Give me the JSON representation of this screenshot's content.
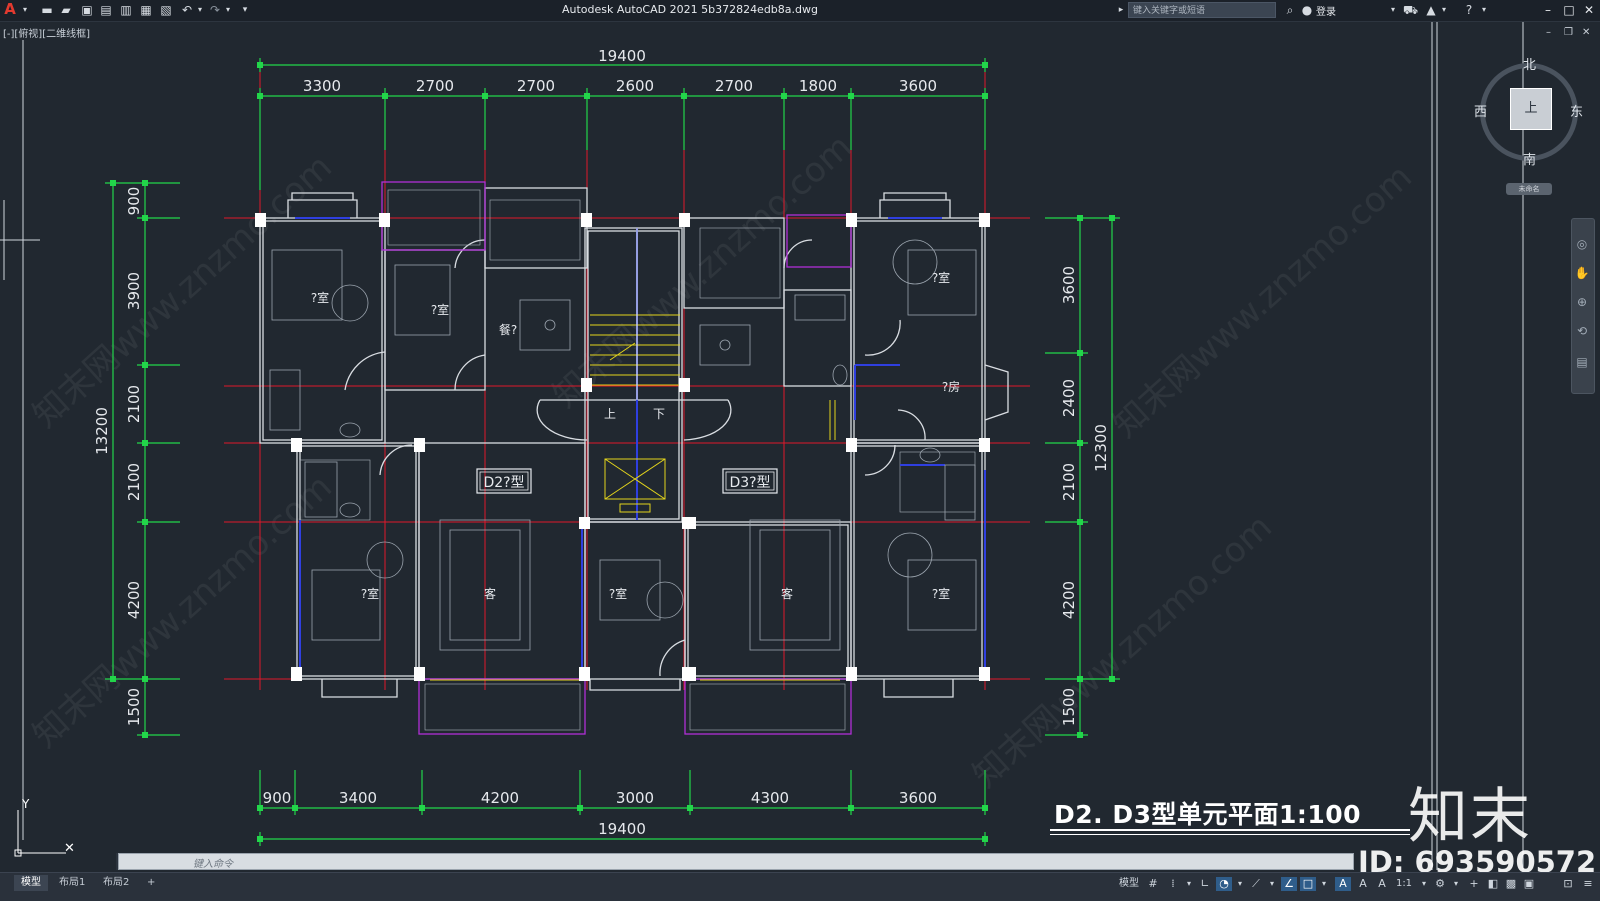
{
  "titlebar": {
    "app_title": "Autodesk AutoCAD 2021     5b372824edb8a.dwg",
    "search_placeholder": "键入关键字或短语",
    "login_label": "登录",
    "logo": "A"
  },
  "viewport_label": "[-][俯视][二维线框]",
  "dimensions": {
    "top_total": "19400",
    "top_segments": [
      "3300",
      "2700",
      "2700",
      "2600",
      "2700",
      "1800",
      "3600"
    ],
    "bottom_segments": [
      "900",
      "3400",
      "4200",
      "3000",
      "4300",
      "3600"
    ],
    "bottom_total": "19400",
    "left_segments": [
      "900",
      "3900",
      "2100",
      "2100",
      "4200",
      "1500"
    ],
    "left_total": "13200",
    "right_segments": [
      "3600",
      "2400",
      "2100",
      "4200",
      "1500"
    ],
    "right_total": "12300"
  },
  "rooms": {
    "bedroom": "?室",
    "dining": "餐?",
    "kitchen": "?房",
    "living": "客",
    "stairs_up": "上",
    "stairs_down": "下",
    "unit_d2": "D2?型",
    "unit_d3": "D3?型"
  },
  "viewcube": {
    "north": "北",
    "south": "南",
    "west": "西",
    "east": "东",
    "face": "上",
    "wcs": "未命名"
  },
  "drawing_title": "D2. D3型单元平面1:100",
  "watermark": {
    "brand": "知末",
    "id": "ID: 693590572",
    "site": "知末网www.znzmo.com"
  },
  "command_line": {
    "placeholder": "键入命令"
  },
  "layout_tabs": [
    "模型",
    "布局1",
    "布局2",
    "+"
  ],
  "statusbar": {
    "model_label": "模型",
    "scale": "1:1"
  },
  "colors": {
    "background": "#212830",
    "dim_green": "#22d64a",
    "axis_red": "#e0182a",
    "wall_white": "#d9dde2",
    "column_fill": "#ffffff",
    "window_blue": "#2f3fe0",
    "yellow": "#e3d41c",
    "magenta": "#b02fd6"
  }
}
